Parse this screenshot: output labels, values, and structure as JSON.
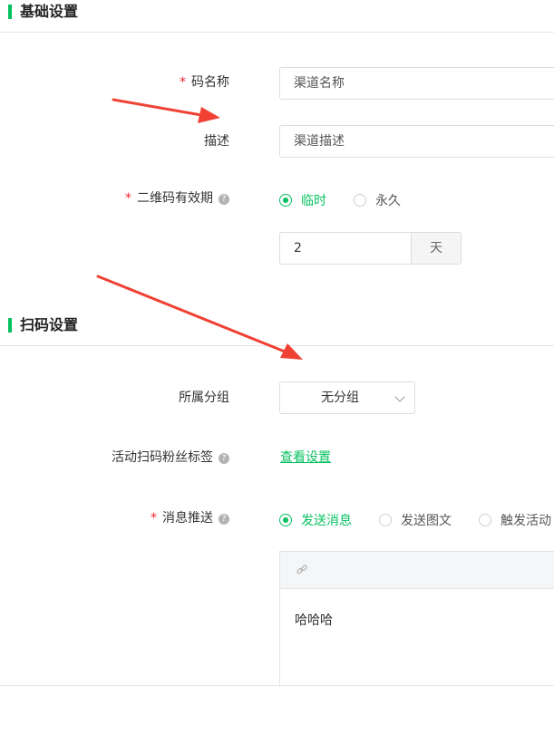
{
  "basic": {
    "title": "基础设置",
    "code_name": {
      "label": "码名称",
      "placeholder": "渠道名称"
    },
    "description": {
      "label": "描述",
      "placeholder": "渠道描述"
    },
    "validity": {
      "label": "二维码有效期",
      "options": [
        "临时",
        "永久"
      ],
      "selected": "临时",
      "days_value": "2",
      "days_unit": "天"
    }
  },
  "scan": {
    "title": "扫码设置",
    "group": {
      "label": "所属分组",
      "value": "无分组"
    },
    "fan_tag": {
      "label": "活动扫码粉丝标签",
      "link": "查看设置"
    },
    "push": {
      "label": "消息推送",
      "options": [
        "发送消息",
        "发送图文",
        "触发活动"
      ],
      "selected": "发送消息",
      "editor_content": "哈哈哈"
    }
  },
  "colors": {
    "accent": "#07c160",
    "required": "#f5222d",
    "arrow": "#f04134"
  },
  "icons": {
    "help": "question-circle-icon",
    "link": "link-icon",
    "dropdown": "chevron-down-icon"
  }
}
